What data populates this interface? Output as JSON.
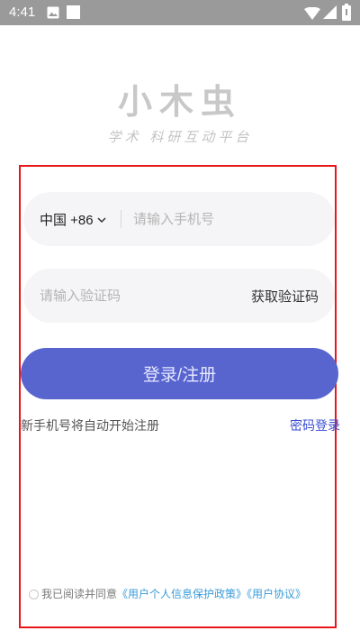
{
  "status_bar": {
    "time": "4:41",
    "left_icons": [
      "image-icon",
      "square-icon"
    ],
    "right_icons": [
      "wifi-icon",
      "signal-icon",
      "battery-icon"
    ]
  },
  "logo": {
    "text": "小木虫",
    "slogan": "学术 科研互动平台"
  },
  "login_form": {
    "country_code": "中国 +86",
    "phone_placeholder": "请输入手机号",
    "code_placeholder": "请输入验证码",
    "get_code_label": "获取验证码",
    "submit_label": "登录/注册",
    "auto_register_hint": "新手机号将自动开始注册",
    "password_login_link": "密码登录"
  },
  "agreement": {
    "prefix": "我已阅读并同意",
    "privacy_policy": "《用户个人信息保护政策》",
    "user_agreement": "《用户协议》",
    "checked": false
  },
  "colors": {
    "primary_button": "#5865cf",
    "link": "#3a4cd0",
    "agreement_link": "#3a9bd9",
    "highlight_border": "#e8161b",
    "status_bar": "#9a9a9a"
  }
}
